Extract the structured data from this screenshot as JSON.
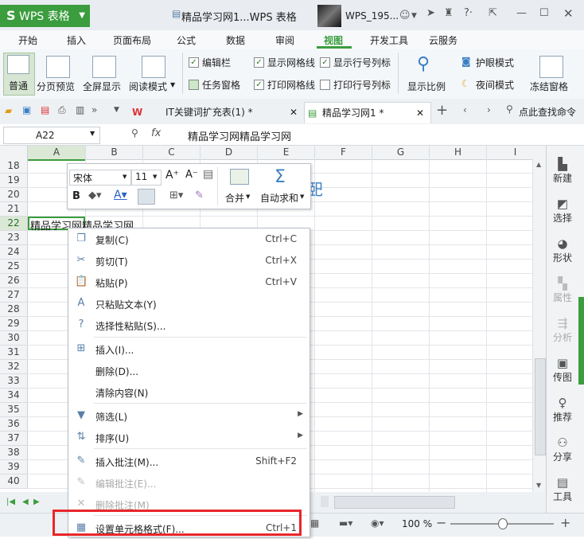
{
  "app": {
    "logo_s": "S",
    "name": "WPS 表格",
    "doc_title": "精品学习网1...WPS 表格",
    "user_name": "WPS_195..."
  },
  "menu_tabs": [
    "开始",
    "插入",
    "页面布局",
    "公式",
    "数据",
    "审阅",
    "视图",
    "开发工具",
    "云服务"
  ],
  "active_tab": "视图",
  "ribbon": {
    "normal": "普通",
    "page_preview": "分页预览",
    "fullscreen": "全屏显示",
    "reading_mode": "阅读模式",
    "edit_bar": "编辑栏",
    "task_pane": "任务窗格",
    "show_grid": "显示网格线",
    "print_grid": "打印网格线",
    "show_headers": "显示行号列标",
    "print_headers": "打印行号列标",
    "zoom_ratio": "显示比例",
    "eye_mode": "护眼模式",
    "night_mode": "夜间模式",
    "freeze": "冻结窗格"
  },
  "doc_tabs": [
    {
      "label": "IT关键词扩充表(1) *"
    },
    {
      "label": "精品学习网1 *"
    }
  ],
  "search_label": "点此查找命令",
  "formula": {
    "cell": "A22",
    "fx": "fx",
    "value": "精品学习网精品学习网"
  },
  "columns": [
    "A",
    "B",
    "C",
    "D",
    "E",
    "F",
    "G",
    "H",
    "I"
  ],
  "rows": [
    "18",
    "19",
    "20",
    "21",
    "22",
    "23",
    "24",
    "25",
    "26",
    "27",
    "28",
    "29",
    "30",
    "31",
    "32",
    "33",
    "34",
    "35",
    "36",
    "37",
    "38",
    "39",
    "40"
  ],
  "cell_a22": "精品学习网精品学习网",
  "mini_toolbar": {
    "font": "宋体",
    "size": "11",
    "merge": "合并",
    "autosum": "自动求和"
  },
  "context_menu": [
    {
      "label": "复制(C)",
      "shortcut": "Ctrl+C",
      "icon": "copy-icon",
      "glyph": "❐"
    },
    {
      "label": "剪切(T)",
      "shortcut": "Ctrl+X",
      "icon": "scissors-icon",
      "glyph": "✂"
    },
    {
      "label": "粘贴(P)",
      "shortcut": "Ctrl+V",
      "icon": "paste-icon",
      "glyph": "📋"
    },
    {
      "label": "只粘贴文本(Y)",
      "shortcut": "",
      "icon": "paste-text-icon",
      "glyph": "A"
    },
    {
      "label": "选择性粘贴(S)...",
      "shortcut": "",
      "icon": "paste-special-icon",
      "glyph": "?"
    },
    {
      "label": "插入(I)...",
      "shortcut": "",
      "icon": "insert-icon",
      "glyph": "⊞"
    },
    {
      "label": "删除(D)...",
      "shortcut": "",
      "icon": "",
      "glyph": ""
    },
    {
      "label": "清除内容(N)",
      "shortcut": "",
      "icon": "",
      "glyph": ""
    },
    {
      "label": "筛选(L)",
      "shortcut": "",
      "icon": "filter-icon",
      "glyph": "▼"
    },
    {
      "label": "排序(U)",
      "shortcut": "",
      "icon": "sort-icon",
      "glyph": "⇅"
    },
    {
      "label": "插入批注(M)...",
      "shortcut": "Shift+F2",
      "icon": "comment-icon",
      "glyph": "✎"
    },
    {
      "label": "编辑批注(E)...",
      "shortcut": "",
      "icon": "edit-comment-icon",
      "glyph": "✎"
    },
    {
      "label": "删除批注(M)",
      "shortcut": "",
      "icon": "delete-comment-icon",
      "glyph": "✕"
    },
    {
      "label": "设置单元格格式(F)...",
      "shortcut": "Ctrl+1",
      "icon": "format-cells-icon",
      "glyph": "▦"
    }
  ],
  "sidebar": [
    "新建",
    "选择",
    "形状",
    "属性",
    "分析",
    "传图",
    "推荐",
    "分享",
    "工具"
  ],
  "status": {
    "zoom": "100 %"
  },
  "colors": {
    "brand_green": "#3b9d3e",
    "highlight_red": "#e8262a"
  }
}
